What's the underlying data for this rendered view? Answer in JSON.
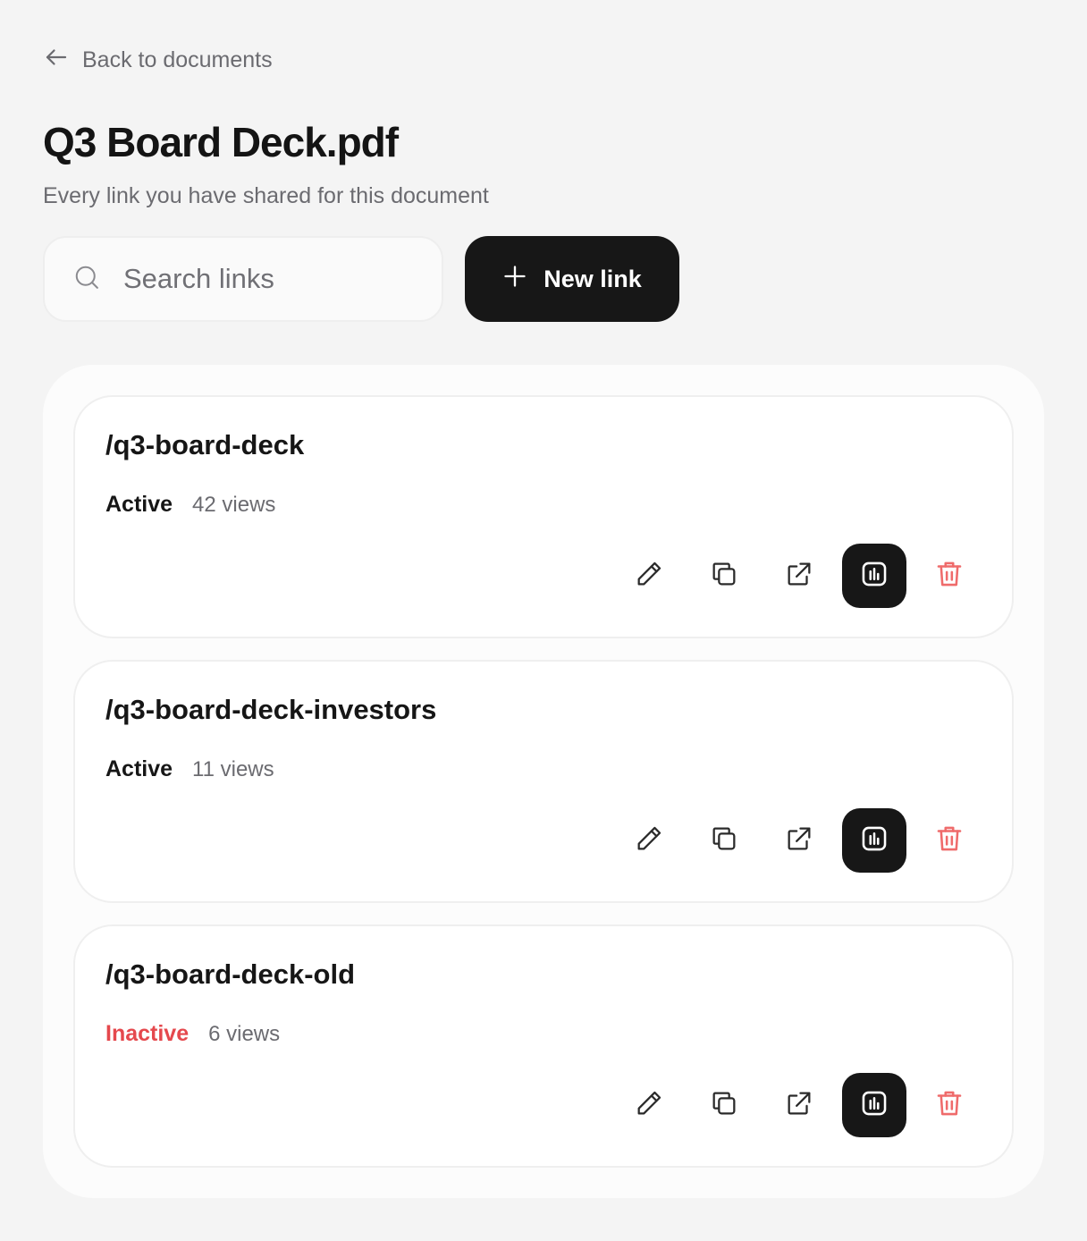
{
  "nav": {
    "back_label": "Back to documents"
  },
  "header": {
    "title": "Q3 Board Deck.pdf",
    "subtitle": "Every link you have shared for this document"
  },
  "toolbar": {
    "search_placeholder": "Search links",
    "search_value": "",
    "new_link_label": "New link"
  },
  "links": [
    {
      "slug": "/q3-board-deck",
      "status": "Active",
      "views": "42 views"
    },
    {
      "slug": "/q3-board-deck-investors",
      "status": "Active",
      "views": "11 views"
    },
    {
      "slug": "/q3-board-deck-old",
      "status": "Inactive",
      "views": "6 views"
    }
  ],
  "actions": [
    "pencil-icon",
    "copy-icon",
    "external-link-icon",
    "analytics-icon",
    "trash-icon"
  ],
  "colors": {
    "background": "#f4f4f4",
    "primary": "#171717",
    "muted_text": "#6b6b70",
    "danger": "#e5484d",
    "danger_icon": "#ef6b6b"
  }
}
